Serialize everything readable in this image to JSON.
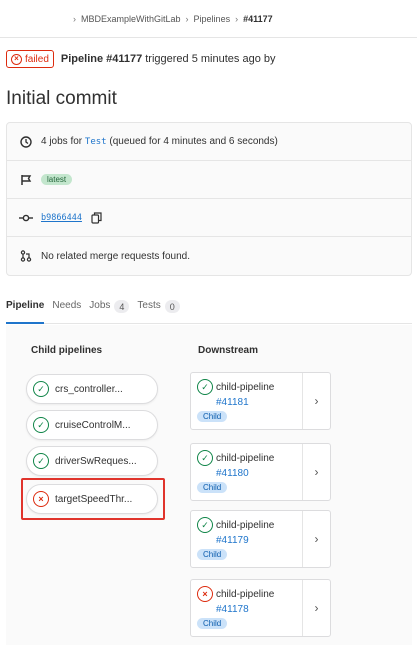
{
  "breadcrumb": {
    "project": "MBDExampleWithGitLab",
    "section": "Pipelines",
    "current": "#41177",
    "separator": "›"
  },
  "pipeline": {
    "status": "failed",
    "title": "Pipeline #41177",
    "trigger_text": "triggered 5 minutes ago by"
  },
  "commit_title": "Initial commit",
  "info": {
    "jobs_prefix": "4 jobs for",
    "jobs_ref": "Test",
    "jobs_suffix": "(queued for 4 minutes and 6 seconds)",
    "latest_badge": "latest",
    "sha": "b9866444",
    "merge_requests": "No related merge requests found."
  },
  "tabs": [
    {
      "label": "Pipeline",
      "count": ""
    },
    {
      "label": "Needs",
      "count": ""
    },
    {
      "label": "Jobs",
      "count": "4"
    },
    {
      "label": "Tests",
      "count": "0"
    }
  ],
  "child_pipelines": {
    "title": "Child pipelines",
    "items": [
      {
        "label": "crs_controller...",
        "status": "passed"
      },
      {
        "label": "cruiseControlM...",
        "status": "passed"
      },
      {
        "label": "driverSwReques...",
        "status": "passed"
      },
      {
        "label": "targetSpeedThr...",
        "status": "failed"
      }
    ]
  },
  "downstream": {
    "title": "Downstream",
    "items": [
      {
        "name": "child-pipeline",
        "number": "#41181",
        "badge": "Child",
        "status": "passed"
      },
      {
        "name": "child-pipeline",
        "number": "#41180",
        "badge": "Child",
        "status": "passed"
      },
      {
        "name": "child-pipeline",
        "number": "#41179",
        "badge": "Child",
        "status": "passed"
      },
      {
        "name": "child-pipeline",
        "number": "#41178",
        "badge": "Child",
        "status": "failed"
      }
    ]
  },
  "colors": {
    "success": "#108548",
    "failed": "#dd2b0e",
    "link": "#1f75cb",
    "highlight": "#e0342c"
  }
}
